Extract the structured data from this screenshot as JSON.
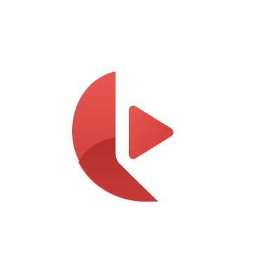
{
  "logo": {
    "icon": "play-logo-icon",
    "colors": {
      "primary_top": "#E9564F",
      "primary_bottom": "#C93C38",
      "shadow": "#B52E2C",
      "play_top": "#E5524B",
      "play_bottom": "#CD3F3A",
      "background": "#FFFFFF"
    }
  }
}
